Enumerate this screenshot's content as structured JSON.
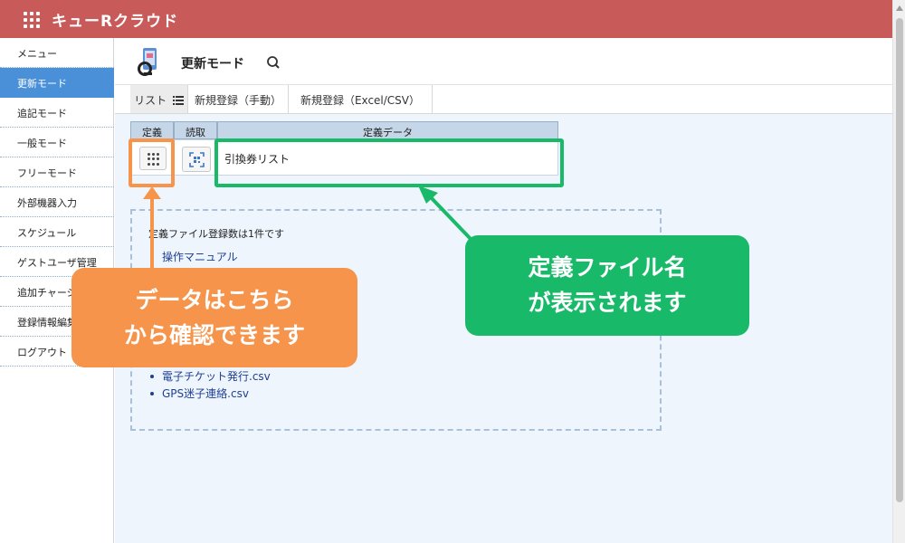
{
  "header": {
    "app_title": "キューRクラウド"
  },
  "sidebar": {
    "items": [
      {
        "label": "メニュー",
        "active": false
      },
      {
        "label": "更新モード",
        "active": true
      },
      {
        "label": "追記モード",
        "active": false
      },
      {
        "label": "一般モード",
        "active": false
      },
      {
        "label": "フリーモード",
        "active": false
      },
      {
        "label": "外部機器入力",
        "active": false
      },
      {
        "label": "スケジュール",
        "active": false
      },
      {
        "label": "ゲストユーザ管理",
        "active": false
      },
      {
        "label": "追加チャージ",
        "active": false
      },
      {
        "label": "登録情報編集",
        "active": false
      },
      {
        "label": "ログアウト",
        "active": false
      }
    ]
  },
  "main": {
    "page_title": "更新モード",
    "tabs": [
      {
        "label": "リスト",
        "icon": "list-icon"
      },
      {
        "label": "新規登録（手動）"
      },
      {
        "label": "新規登録（Excel/CSV）"
      }
    ],
    "table": {
      "headers": {
        "definition": "定義",
        "read": "読取",
        "data": "定義データ"
      },
      "row": {
        "data_value": "引換券リスト"
      }
    },
    "info": {
      "count_text": "定義ファイル登録数は1件です",
      "files": [
        "操作マニュアル",
        "電子チケット発行.csv",
        "GPS迷子連絡.csv"
      ]
    }
  },
  "annotations": {
    "orange_callout": [
      "データはこちら",
      "から確認できます"
    ],
    "green_callout": [
      "定義ファイル名",
      "が表示されます"
    ],
    "orange_color": "#f5944a",
    "green_color": "#19b96a"
  }
}
